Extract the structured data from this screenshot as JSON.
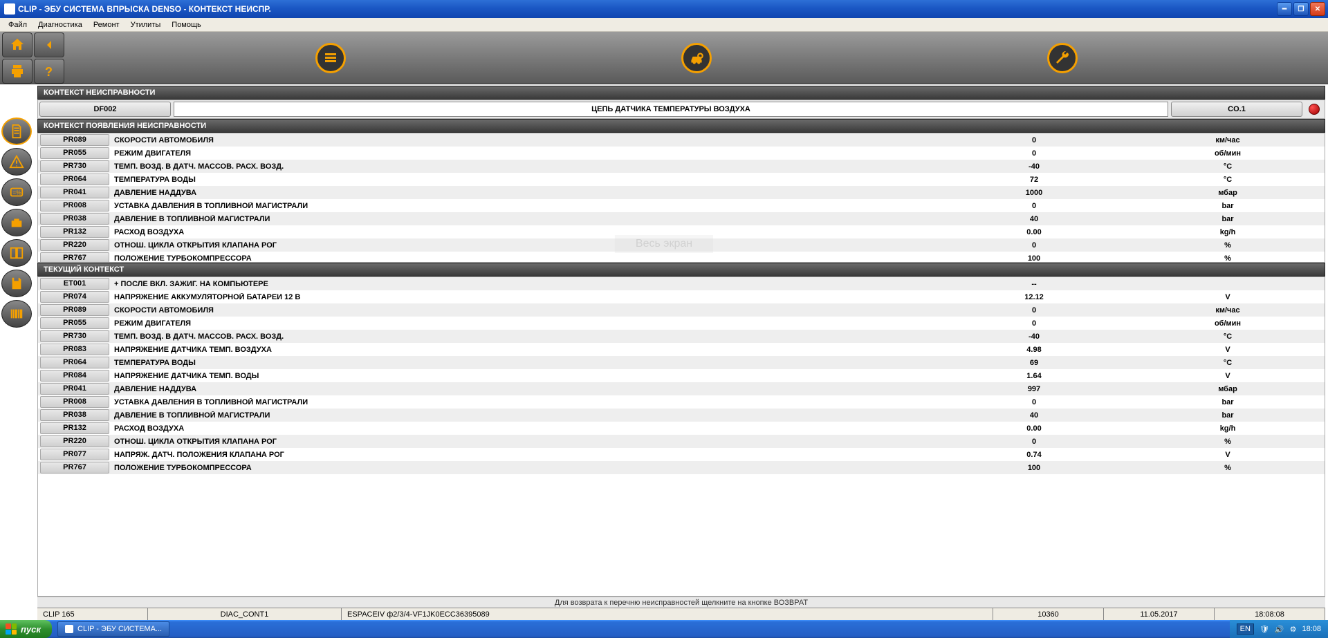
{
  "window": {
    "title": "CLIP - ЭБУ СИСТЕМА ВПРЫСКА DENSO - КОНТЕКСТ НЕИСПР."
  },
  "menu": [
    "Файл",
    "Диагностика",
    "Ремонт",
    "Утилиты",
    "Помощь"
  ],
  "sections": {
    "fault_ctx": "КОНТЕКСТ НЕИСПРАВНОСТИ",
    "occur_ctx": "КОНТЕКСТ ПОЯВЛЕНИЯ НЕИСПРАВНОСТИ",
    "current_ctx": "ТЕКУЩИЙ КОНТЕКСТ"
  },
  "fault": {
    "code": "DF002",
    "desc": "ЦЕПЬ ДАТЧИКА ТЕМПЕРАТУРЫ ВОЗДУХА",
    "status": "CO.1"
  },
  "occurrence": [
    {
      "code": "PR089",
      "label": "СКОРОСТИ АВТОМОБИЛЯ",
      "value": "0",
      "unit": "км/час"
    },
    {
      "code": "PR055",
      "label": "РЕЖИМ ДВИГАТЕЛЯ",
      "value": "0",
      "unit": "об/мин"
    },
    {
      "code": "PR730",
      "label": "ТЕМП. ВОЗД. В ДАТЧ. МАССОВ. РАСХ. ВОЗД.",
      "value": "-40",
      "unit": "°C"
    },
    {
      "code": "PR064",
      "label": "ТЕМПЕРАТУРА ВОДЫ",
      "value": "72",
      "unit": "°C"
    },
    {
      "code": "PR041",
      "label": "ДАВЛЕНИЕ НАДДУВА",
      "value": "1000",
      "unit": "мбар"
    },
    {
      "code": "PR008",
      "label": "УСТАВКА ДАВЛЕНИЯ В ТОПЛИВНОЙ МАГИСТРАЛИ",
      "value": "0",
      "unit": "bar"
    },
    {
      "code": "PR038",
      "label": "ДАВЛЕНИЕ В ТОПЛИВНОЙ МАГИСТРАЛИ",
      "value": "40",
      "unit": "bar"
    },
    {
      "code": "PR132",
      "label": "РАСХОД ВОЗДУХА",
      "value": "0.00",
      "unit": "kg/h"
    },
    {
      "code": "PR220",
      "label": "ОТНОШ. ЦИКЛА ОТКРЫТИЯ КЛАПАНА РОГ",
      "value": "0",
      "unit": "%"
    },
    {
      "code": "PR767",
      "label": "ПОЛОЖЕНИЕ ТУРБОКОМПРЕССОРА",
      "value": "100",
      "unit": "%"
    }
  ],
  "current": [
    {
      "code": "ET001",
      "label": "+ ПОСЛЕ ВКЛ. ЗАЖИГ. НА КОМПЬЮТЕРЕ",
      "value": "--",
      "unit": ""
    },
    {
      "code": "PR074",
      "label": "НАПРЯЖЕНИЕ АККУМУЛЯТОРНОЙ БАТАРЕИ 12 В",
      "value": "12.12",
      "unit": "V"
    },
    {
      "code": "PR089",
      "label": "СКОРОСТИ АВТОМОБИЛЯ",
      "value": "0",
      "unit": "км/час"
    },
    {
      "code": "PR055",
      "label": "РЕЖИМ ДВИГАТЕЛЯ",
      "value": "0",
      "unit": "об/мин"
    },
    {
      "code": "PR730",
      "label": "ТЕМП. ВОЗД. В ДАТЧ. МАССОВ. РАСХ. ВОЗД.",
      "value": "-40",
      "unit": "°C"
    },
    {
      "code": "PR083",
      "label": "НАПРЯЖЕНИЕ ДАТЧИКА ТЕМП. ВОЗДУХА",
      "value": "4.98",
      "unit": "V"
    },
    {
      "code": "PR064",
      "label": "ТЕМПЕРАТУРА ВОДЫ",
      "value": "69",
      "unit": "°C"
    },
    {
      "code": "PR084",
      "label": "НАПРЯЖЕНИЕ ДАТЧИКА ТЕМП. ВОДЫ",
      "value": "1.64",
      "unit": "V"
    },
    {
      "code": "PR041",
      "label": "ДАВЛЕНИЕ НАДДУВА",
      "value": "997",
      "unit": "мбар"
    },
    {
      "code": "PR008",
      "label": "УСТАВКА ДАВЛЕНИЯ В ТОПЛИВНОЙ МАГИСТРАЛИ",
      "value": "0",
      "unit": "bar"
    },
    {
      "code": "PR038",
      "label": "ДАВЛЕНИЕ В ТОПЛИВНОЙ МАГИСТРАЛИ",
      "value": "40",
      "unit": "bar"
    },
    {
      "code": "PR132",
      "label": "РАСХОД ВОЗДУХА",
      "value": "0.00",
      "unit": "kg/h"
    },
    {
      "code": "PR220",
      "label": "ОТНОШ. ЦИКЛА ОТКРЫТИЯ КЛАПАНА РОГ",
      "value": "0",
      "unit": "%"
    },
    {
      "code": "PR077",
      "label": "НАПРЯЖ. ДАТЧ. ПОЛОЖЕНИЯ КЛАПАНА РОГ",
      "value": "0.74",
      "unit": "V"
    },
    {
      "code": "PR767",
      "label": "ПОЛОЖЕНИЕ ТУРБОКОМПРЕССОРА",
      "value": "100",
      "unit": "%"
    }
  ],
  "hint": "Для возврата к перечню неисправностей щелкните на кнопке ВОЗВРАТ",
  "status": {
    "clip": "CLIP 165",
    "diac": "DIAC_CONT1",
    "vin": "ESPACEIV ф2/3/4-VF1JK0ECC36395089",
    "num": "10360",
    "date": "11.05.2017",
    "time": "18:08:08"
  },
  "taskbar": {
    "start": "пуск",
    "task1": "CLIP - ЭБУ СИСТЕМА...",
    "lang": "EN",
    "clock": "18:08"
  },
  "watermark": "Весь экран"
}
